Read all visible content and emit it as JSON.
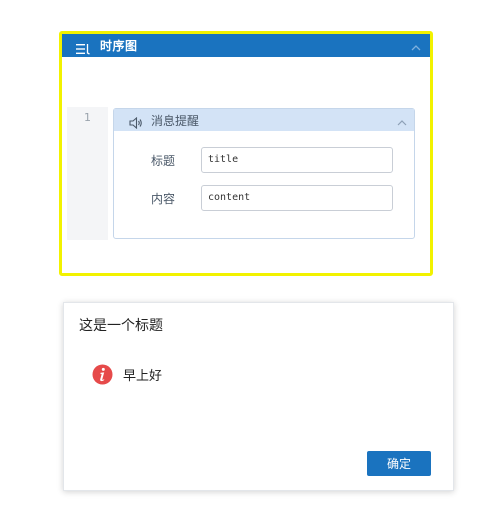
{
  "panel": {
    "title": "时序图",
    "icon": "list-lines-icon",
    "collapse_icon": "chevron-up-icon",
    "header_color": "#1a73bf",
    "border_color": "#f2f200"
  },
  "gutter": {
    "line_number": "1"
  },
  "message_card": {
    "icon": "speaker-icon",
    "title": "消息提醒",
    "collapse_icon": "chevron-up-icon",
    "fields": [
      {
        "label": "标题",
        "value": "title"
      },
      {
        "label": "内容",
        "value": "content"
      }
    ]
  },
  "dialog": {
    "title": "这是一个标题",
    "icon": "info-icon",
    "icon_color": "#e64a4a",
    "message": "早上好",
    "ok_label": "确定",
    "button_color": "#1a73bf"
  }
}
